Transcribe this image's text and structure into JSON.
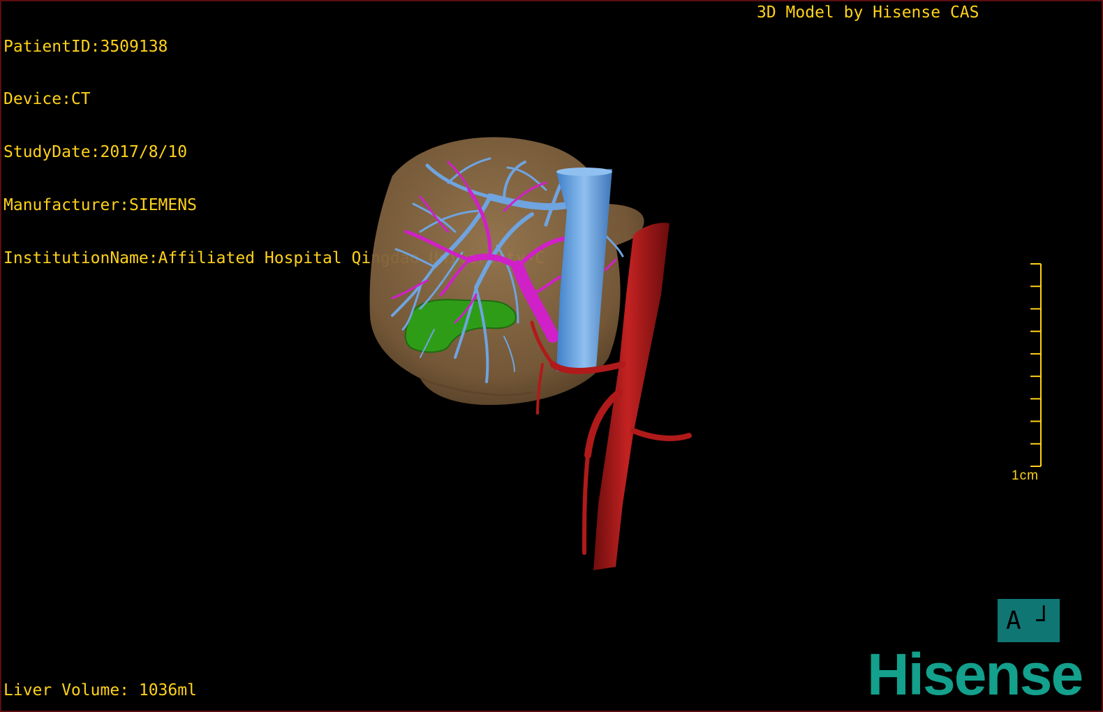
{
  "header": {
    "patient_id": "PatientID:3509138",
    "device": "Device:CT",
    "study_date": "StudyDate:2017/8/10",
    "manufacturer": "Manufacturer:SIEMENS",
    "institution": "InstitutionName:Affiliated Hospital Qingdao University-C"
  },
  "credit": "3D Model by Hisense CAS",
  "footer": {
    "liver_volume": "Liver Volume: 1036ml"
  },
  "scale_bar": {
    "label": "1cm",
    "tick_count": 10
  },
  "orientation": {
    "label": "A ┘"
  },
  "brand": {
    "name": "Hisense"
  },
  "model": {
    "structures": [
      "liver-icon",
      "hepatic-vein-icon",
      "portal-vein-icon",
      "inferior-vena-cava-icon",
      "aorta-icon",
      "gallbladder-icon"
    ]
  },
  "colors": {
    "text": "#ffd21a",
    "liver": "#8b6b45",
    "hepatic_veins": "#6fa4e0",
    "portal_veins": "#d020c8",
    "artery": "#b01a1a",
    "gallbladder": "#2f9c18",
    "orientation_box": "#0f7674",
    "brand": "#13a08c"
  }
}
